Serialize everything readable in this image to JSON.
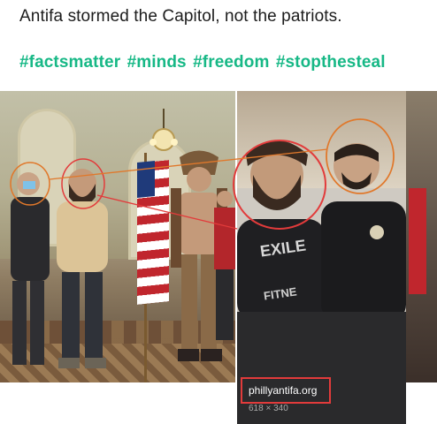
{
  "post": {
    "text": "Antifa stormed the Capitol, not the patriots.",
    "hashtags": [
      "#factsmatter",
      "#minds",
      "#freedom",
      "#stopthesteal"
    ]
  },
  "image": {
    "caption_site": "phillyantifa.org",
    "caption_dims": "618 × 340",
    "right_shirt_text": "EXILE",
    "right_shirt_text2": "FITNE"
  },
  "colors": {
    "hashtag": "#17b886",
    "annotation_circle": "#e23b3b",
    "annotation_line": "#e0782b"
  }
}
